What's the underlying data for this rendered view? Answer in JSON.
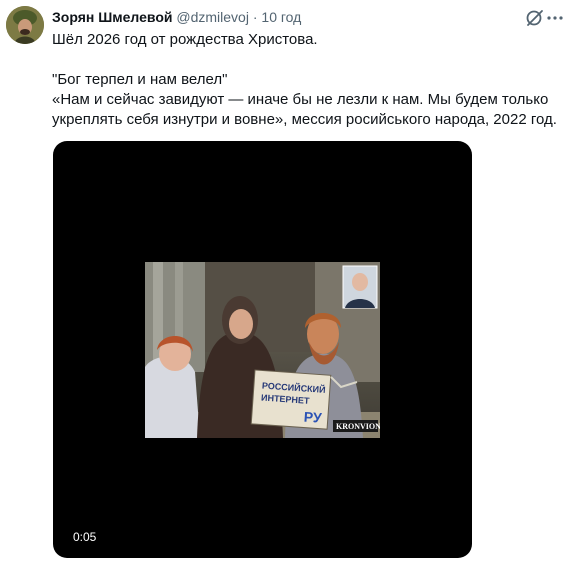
{
  "tweet": {
    "author_name": "Зорян Шмелевой",
    "handle": "@dzmilevoj",
    "separator": "·",
    "timestamp": "10 год",
    "lines": [
      "Шёл 2026 год от рождества Христова.",
      "",
      "\"Бог терпел и нам велел\"",
      "«Нам и сейчас завидуют — иначе бы не лезли к нам. Мы будем только",
      "укреплять себя изнутри и вовне», мессия росийського народа, 2022 год."
    ]
  },
  "media": {
    "box_text": [
      "РОССИЙСКИЙ",
      "ИНТЕРНЕТ",
      "РУ"
    ],
    "watermark": "KRONVION",
    "duration": "0:05"
  },
  "icons": {
    "grok": "slashed-circle-icon",
    "more": "more-dots-icon"
  },
  "colors": {
    "text": "#0f1419",
    "secondary": "#536471",
    "media_bg": "#000000"
  }
}
